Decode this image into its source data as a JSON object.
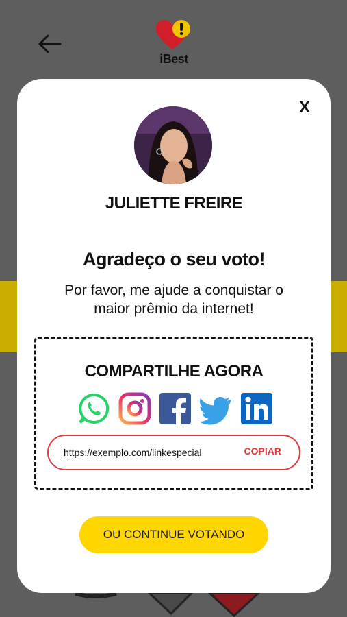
{
  "header": {
    "back_icon": "arrow-left-icon",
    "logo_text": "iBest",
    "logo_icon": "heart-exclamation-logo"
  },
  "modal": {
    "close_label": "X",
    "avatar_icon": "profile-photo",
    "name": "JULIETTE FREIRE",
    "thanks": "Agradeço o seu voto!",
    "subtitle": "Por favor, me ajude a conquistar o maior prêmio da internet!",
    "share": {
      "title": "COMPARTILHE AGORA",
      "networks": [
        "whatsapp-icon",
        "instagram-icon",
        "facebook-icon",
        "twitter-icon",
        "linkedin-icon"
      ],
      "link_value": "https://exemplo.com/linkespecial",
      "copy_label": "COPIAR"
    },
    "continue_label": "OU CONTINUE VOTANDO"
  },
  "colors": {
    "accent_yellow": "#ffd600",
    "copy_red": "#e23b3b",
    "overlay": "#5e5e5e"
  }
}
